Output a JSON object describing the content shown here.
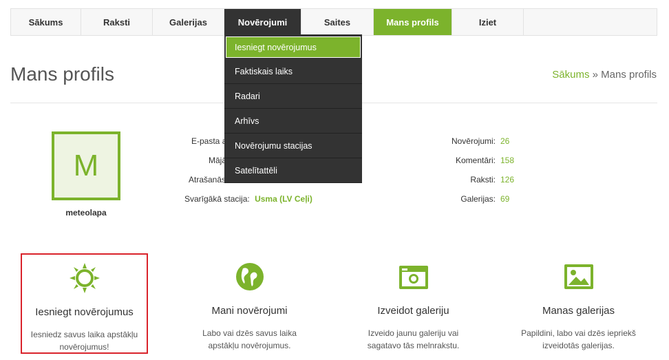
{
  "nav": {
    "items": [
      {
        "label": "Sākums"
      },
      {
        "label": "Raksti"
      },
      {
        "label": "Galerijas"
      },
      {
        "label": "Novērojumi"
      },
      {
        "label": "Saites"
      },
      {
        "label": "Mans profils"
      },
      {
        "label": "Iziet"
      }
    ]
  },
  "dropdown": {
    "items": [
      {
        "label": "Iesniegt novērojumus"
      },
      {
        "label": "Faktiskais laiks"
      },
      {
        "label": "Radari"
      },
      {
        "label": "Arhīvs"
      },
      {
        "label": "Novērojumu stacijas"
      },
      {
        "label": "Satelītattēli"
      }
    ]
  },
  "header": {
    "title": "Mans profils",
    "breadcrumb_home": "Sākums",
    "breadcrumb_sep": " » ",
    "breadcrumb_current": "Mans profils"
  },
  "profile": {
    "avatar_letter": "M",
    "username": "meteolapa",
    "email_label": "E-pasta a",
    "home_label": "Mājā",
    "location_label": "Atrašanās",
    "station_label": "Svarīgākā stacija:",
    "station_value": "Usma (LV Ceļi)"
  },
  "stats": [
    {
      "label": "Novērojumi:",
      "value": "26"
    },
    {
      "label": "Komentāri:",
      "value": "158"
    },
    {
      "label": "Raksti:",
      "value": "126"
    },
    {
      "label": "Galerijas:",
      "value": "69"
    }
  ],
  "features": [
    {
      "icon": "sun-icon",
      "title": "Iesniegt novērojumus",
      "desc": "Iesniedz savus laika apstākļu novērojumus!"
    },
    {
      "icon": "globe-icon",
      "title": "Mani novērojumi",
      "desc": "Labo vai dzēs savus laika apstākļu novērojumus."
    },
    {
      "icon": "camera-icon",
      "title": "Izveidot galeriju",
      "desc": "Izveido jaunu galeriju vai sagatavo tās melnrakstu."
    },
    {
      "icon": "image-icon",
      "title": "Manas galerijas",
      "desc": "Papildini, labo vai dzēs iepriekš izveidotās galerijas."
    }
  ],
  "colors": {
    "accent": "#7cb32c",
    "dark": "#333333",
    "highlight": "#d9232b"
  }
}
